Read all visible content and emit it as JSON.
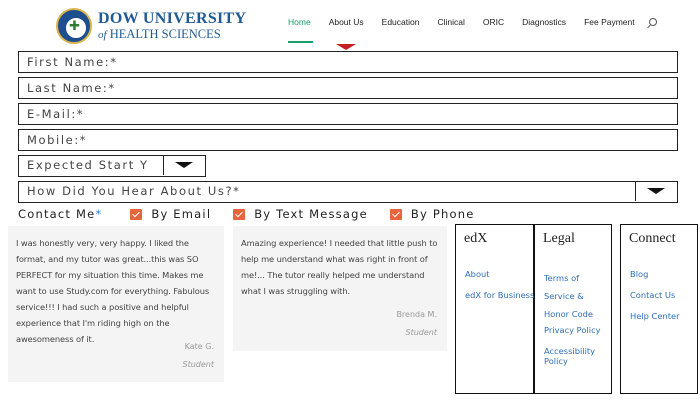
{
  "header": {
    "logo": {
      "line1": "DOW UNIVERSITY",
      "line2_of": "of",
      "line2": "HEALTH SCIENCES"
    },
    "nav": [
      {
        "label": "Home",
        "active": true
      },
      {
        "label": "About Us",
        "active": false
      },
      {
        "label": "Education",
        "active": false
      },
      {
        "label": "Clinical",
        "active": false
      },
      {
        "label": "ORIC",
        "active": false
      },
      {
        "label": "Diagnostics",
        "active": false
      },
      {
        "label": "Fee Payment",
        "active": false
      }
    ],
    "accent_color": "#18a06b",
    "caret_color": "#c51f26"
  },
  "form": {
    "first_name": {
      "placeholder": "First Name:*",
      "value": ""
    },
    "last_name": {
      "placeholder": "Last Name:*",
      "value": ""
    },
    "email": {
      "placeholder": "E-Mail:*",
      "value": ""
    },
    "mobile": {
      "placeholder": "Mobile:*",
      "value": ""
    },
    "expected_start": {
      "selected": "Expected Start Y"
    },
    "hear_about": {
      "selected": "How Did You Hear About Us?*"
    },
    "contact_me": {
      "label": "Contact Me",
      "required_mark": "*",
      "options": [
        {
          "label": "By Email",
          "checked": true
        },
        {
          "label": "By Text Message",
          "checked": true
        },
        {
          "label": "By Phone",
          "checked": true
        }
      ],
      "checkbox_color": "#e8643c"
    }
  },
  "testimonials": [
    {
      "quote": "I was honestly very, very happy. I liked the format, and my tutor was great...this was SO PERFECT for my situation this time. Makes me want to use Study.com for everything. Fabulous service!!! I had such a positive and helpful experience that I'm riding high on the awesomeness of it.",
      "name": "Kate G.",
      "role": "Student"
    },
    {
      "quote": "Amazing experience! I needed that little push to help me understand what was right in front of me!... The tutor really helped me understand what I was struggling with.",
      "name": "Brenda M.",
      "role": "Student"
    }
  ],
  "footer": {
    "edx": {
      "heading": "edX",
      "links": [
        "About",
        "edX for Business"
      ]
    },
    "legal": {
      "heading": "Legal",
      "links": [
        "Terms of Service & Honor Code",
        "Privacy Policy",
        "Accessibility Policy"
      ]
    },
    "connect": {
      "heading": "Connect",
      "links": [
        "Blog",
        "Contact Us",
        "Help Center"
      ]
    },
    "link_color": "#2f6eb5"
  }
}
